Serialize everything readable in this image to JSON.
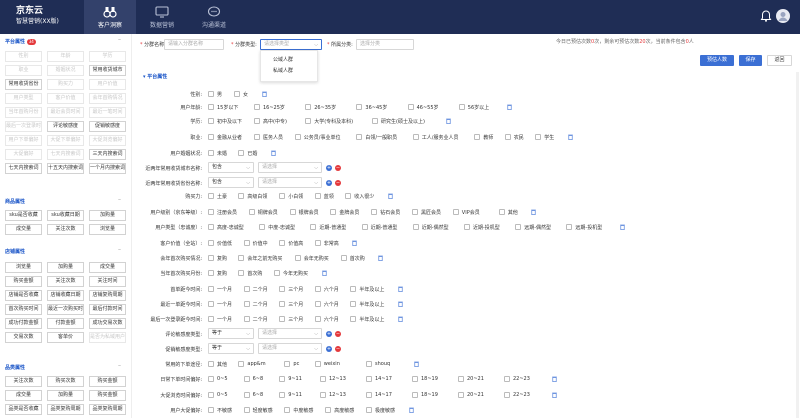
{
  "header": {
    "brand": "京东云",
    "product": "智慧营销(XX版)",
    "nav": [
      {
        "label": "客户洞察",
        "icon": "binoculars-icon",
        "active": true
      },
      {
        "label": "数据营销",
        "icon": "monitor-icon",
        "active": false
      },
      {
        "label": "沟通渠道",
        "icon": "chat-icon",
        "active": false
      }
    ]
  },
  "form": {
    "name_label": "分群名称:",
    "name_placeholder": "请输入分群名称",
    "type_label": "分群类型:",
    "type_placeholder": "请选择类型",
    "category_label": "所属分类:",
    "category_placeholder": "选择分类",
    "type_options": [
      "公域人群",
      "私域人群"
    ]
  },
  "quota": {
    "prefix": "今日已预估次数",
    "used": "0",
    "mid1": "次，剩余可预估次数",
    "remain": "20",
    "mid2": "次，当前条件包含",
    "count": "0",
    "suffix": "人"
  },
  "actions": {
    "estimate": "预估人数",
    "save": "保存",
    "back": "返回"
  },
  "sidebar": {
    "sec1": {
      "title": "平台属性",
      "badge": "34"
    },
    "tags1": [
      "性别",
      "年龄",
      "学历",
      "职业",
      "婚姻状况",
      "常用收货城市",
      "常用收货省份",
      "购买力",
      "用户价值",
      "用户类型",
      "客户价值",
      "会年首购情况",
      "当年首购月份",
      "最近会员时间",
      "最近一笔时间",
      "最后一次登录时间",
      "评论敏感度",
      "促销敏感度",
      "用户下单偏好",
      "大促下单偏好",
      "大促浏览偏好",
      "大促偏好",
      "七天内搜索词",
      "三天内搜索词",
      "七天内搜索词",
      "十五天内搜索词",
      "一个月内搜索词"
    ],
    "tags1_enabled": [
      false,
      false,
      false,
      false,
      false,
      true,
      true,
      false,
      false,
      false,
      false,
      false,
      false,
      false,
      false,
      false,
      true,
      true,
      false,
      false,
      false,
      false,
      false,
      true,
      true,
      true,
      true
    ],
    "sec2": {
      "title": "商品属性"
    },
    "tags2": [
      "sku是否收藏",
      "sku收藏日期",
      "加购量",
      "成交量",
      "关注次数",
      "浏览量"
    ],
    "sec3": {
      "title": "店铺属性"
    },
    "tags3": [
      "浏览量",
      "加购量",
      "成交量",
      "购买金额",
      "关注次数",
      "关注时间",
      "店铺是否收藏",
      "店铺收藏日期",
      "店铺复购周期",
      "首次购买时间",
      "最近一次购买时间",
      "最后付款时间",
      "成功付款金额",
      "付款金额",
      "成功交易次数",
      "交易次数",
      "客单价",
      "是否为私域用户"
    ],
    "tags3_enabled": [
      true,
      true,
      true,
      true,
      true,
      true,
      true,
      true,
      true,
      true,
      true,
      true,
      true,
      true,
      true,
      true,
      true,
      false
    ],
    "sec4": {
      "title": "品类属性"
    },
    "tags4": [
      "关注次数",
      "购买次数",
      "购买金额",
      "成交量",
      "加购量",
      "购买金额",
      "品类是否收藏",
      "品类复购周期",
      "品类复购周期"
    ]
  },
  "main": {
    "title": "平台属性",
    "rows": [
      {
        "label": "性别:",
        "options": [
          "男",
          "女"
        ],
        "trash": true
      },
      {
        "label": "用户年龄:",
        "options": [
          "15岁以下",
          "16~25岁",
          "26~35岁",
          "36~45岁",
          "46~55岁",
          "56岁以上"
        ],
        "trash": true
      },
      {
        "label": "学历:",
        "options": [
          "初中及以下",
          "高中(中专)",
          "大学(专科及本科)",
          "研究生(硕士及以上)"
        ],
        "trash": true
      },
      {
        "label": "职业:",
        "options": [
          "金融从业者",
          "医务人员",
          "公务员/事业单位",
          "白领/一般职员",
          "工人/服务业人员",
          "教师",
          "农民",
          "学生"
        ],
        "trash": true
      },
      {
        "label": "用户婚姻状况:",
        "options": [
          "未婚",
          "已婚"
        ],
        "trash": true
      },
      {
        "label": "近两年常用收货城市名称:",
        "select": "包含",
        "placeholder": "请选择",
        "buttons": true
      },
      {
        "label": "近两年常用收货省份名称:",
        "select": "包含",
        "placeholder": "请选择",
        "buttons": true
      },
      {
        "label": "购买力:",
        "options": [
          "土豪",
          "高级白领",
          "小白领",
          "蓝领",
          "收入很少"
        ],
        "trash": true
      },
      {
        "label": "用户级别（京东等级）:",
        "options": [
          "注册会员",
          "铜牌会员",
          "银牌会员",
          "金牌会员",
          "钻石会员",
          "黑匠会员",
          "VIP会员",
          "其他"
        ],
        "trash": true
      },
      {
        "label": "用户类型（忠诚度）:",
        "options": [
          "高度-忠诚型",
          "中度-忠诚型",
          "近期-普通型",
          "近期-普通型",
          "近期-偶然型",
          "近期-投机型",
          "远期-偶然型",
          "远期-投机型"
        ],
        "trash": true
      },
      {
        "label": "客户价值（全站）:",
        "options": [
          "价值低",
          "价值中",
          "价值高",
          "非常高"
        ],
        "trash": true
      },
      {
        "label": "会年首次购买情况:",
        "options": [
          "复购",
          "会年之前无购买",
          "会年无购买",
          "首次购"
        ],
        "trash": true
      },
      {
        "label": "当年首次购买月份:",
        "options": [
          "复购",
          "首次购",
          "今年无购买"
        ],
        "trash": true
      },
      {
        "label": "首单距今时间:",
        "options": [
          "一个月",
          "二个月",
          "三个月",
          "六个月",
          "半年及以上"
        ],
        "trash": true
      },
      {
        "label": "最近一单距今时间:",
        "options": [
          "一个月",
          "二个月",
          "三个月",
          "六个月",
          "半年及以上"
        ],
        "trash": true
      },
      {
        "label": "最后一次登录距今时间:",
        "options": [
          "一个月",
          "二个月",
          "三个月",
          "六个月",
          "半年及以上"
        ],
        "trash": true
      },
      {
        "label": "评论敏感度类型:",
        "select": "等于",
        "placeholder": "请选择",
        "buttons": true
      },
      {
        "label": "促销敏感度类型:",
        "select": "等于",
        "placeholder": "请选择",
        "buttons": true
      },
      {
        "label": "常用的下单途径:",
        "options": [
          "其他",
          "app&m",
          "pc",
          "weixin",
          "shouq"
        ],
        "trash": true
      },
      {
        "label": "日常下单时间偏好:",
        "options": [
          "0~5",
          "6~8",
          "9~11",
          "12~13",
          "14~17",
          "18~19",
          "20~21",
          "22~23"
        ],
        "trash": true
      },
      {
        "label": "大促浏览时间偏好:",
        "options": [
          "0~5",
          "6~8",
          "9~11",
          "12~13",
          "14~17",
          "18~19",
          "20~21",
          "22~23"
        ],
        "trash": true
      },
      {
        "label": "用户大促偏好:",
        "options": [
          "不敏感",
          "轻度敏感",
          "中度敏感",
          "高度敏感",
          "极度敏感"
        ],
        "trash": true
      }
    ]
  }
}
